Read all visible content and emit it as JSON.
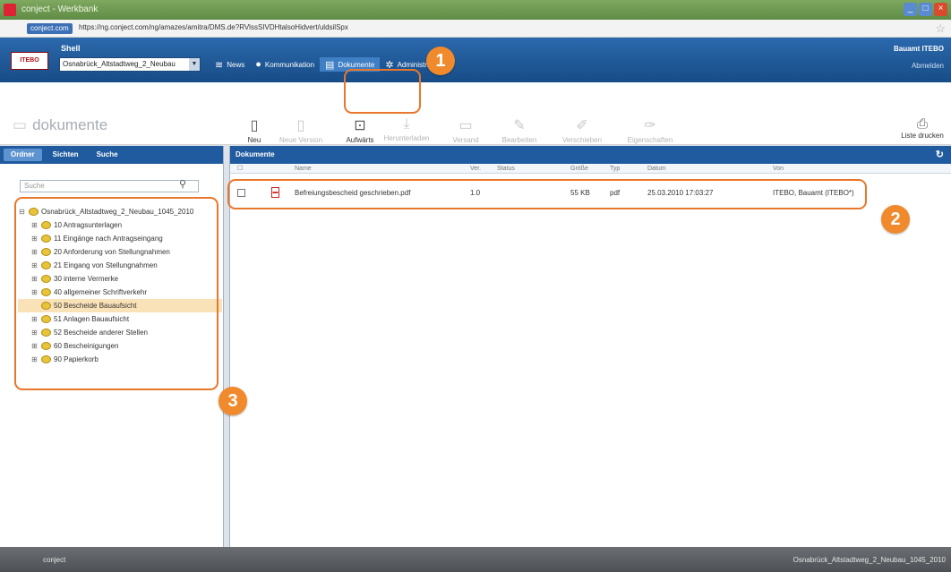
{
  "window": {
    "title": "conject - Werkbank"
  },
  "address": {
    "site": "conject.com",
    "url": "https://ng.conject.com/ng/amazes/amitra/DMS.de?RVlssSIVDHtalsoHidvert/uldsilSpx"
  },
  "header": {
    "project_label": "Shell",
    "project_value": "Osnabrück_Altstadtweg_2_Neubau",
    "nav": [
      "News",
      "Kommunikation",
      "Dokumente",
      "Administration"
    ],
    "user_name": "Bauamt ITEBO",
    "user_sub": "Abmelden"
  },
  "toolbar": {
    "module_title": "dokumente",
    "tools": [
      "Neu",
      "Neue Version",
      "Aufwärts",
      "Herunterladen",
      "Versand",
      "Bearbeiten",
      "Verschieben",
      "Eigenschaften"
    ],
    "print": "Liste drucken"
  },
  "left": {
    "tabs": [
      "Ordner",
      "Sichten",
      "Suche"
    ],
    "search_placeholder": "Suche",
    "tree_root": "Osnabrück_Altstadtweg_2_Neubau_1045_2010",
    "tree_items": [
      "10 Antragsunterlagen",
      "11 Eingänge nach Antragseingang",
      "20 Anforderung von Stellungnahmen",
      "21 Eingang von Stellungnahmen",
      "30 interne Vermerke",
      "40 allgemeiner Schriftverkehr",
      "50 Bescheide Bauaufsicht",
      "51 Anlagen Bauaufsicht",
      "52 Bescheide anderer Stellen",
      "60 Bescheinigungen",
      "90 Papierkorb"
    ]
  },
  "right": {
    "header": "Dokumente",
    "columns": [
      "Name",
      "Ver.",
      "Status",
      "Größe",
      "Typ",
      "Datum",
      "Von"
    ],
    "rows": [
      {
        "name": "Befreiungsbescheid geschrieben.pdf",
        "ver": "1.0",
        "status": "",
        "size": "55 KB",
        "type": "pdf",
        "date": "25.03.2010 17:03:27",
        "from": "ITEBO, Bauamt (ITEBO*)"
      }
    ]
  },
  "callouts": [
    "1",
    "2",
    "3"
  ],
  "status": {
    "left": "conject",
    "right": "Osnabrück_Altstadtweg_2_Neubau_1045_2010"
  }
}
